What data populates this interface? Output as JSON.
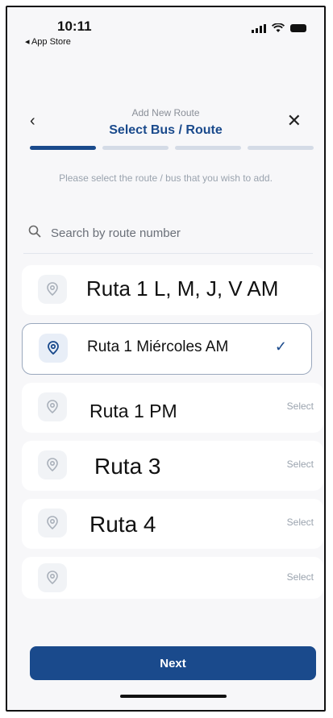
{
  "status_bar": {
    "time": "10:11",
    "back_app": "◂ App Store"
  },
  "header": {
    "subtitle": "Add New Route",
    "title": "Select Bus / Route",
    "back_icon": "‹",
    "close_icon": "✕"
  },
  "progress": {
    "steps": 4,
    "current": 1
  },
  "instruction": "Please select the route / bus that you wish to add.",
  "search": {
    "placeholder": "Search by route number",
    "value": ""
  },
  "routes": [
    {
      "label": "Ruta 1 L, M, J, V AM",
      "action": "",
      "selected": false
    },
    {
      "label": "Ruta 1 Miércoles AM",
      "action": "✓",
      "selected": true
    },
    {
      "label": "Ruta 1 PM",
      "action": "Select",
      "selected": false
    },
    {
      "label": "Ruta 3",
      "action": "Select",
      "selected": false
    },
    {
      "label": "Ruta 4",
      "action": "Select",
      "selected": false
    },
    {
      "label": "",
      "action": "Select",
      "selected": false
    }
  ],
  "next_button": {
    "label": "Next"
  },
  "colors": {
    "primary": "#1a4a8c",
    "muted": "#9aa3ae",
    "background": "#f7f7f9"
  }
}
